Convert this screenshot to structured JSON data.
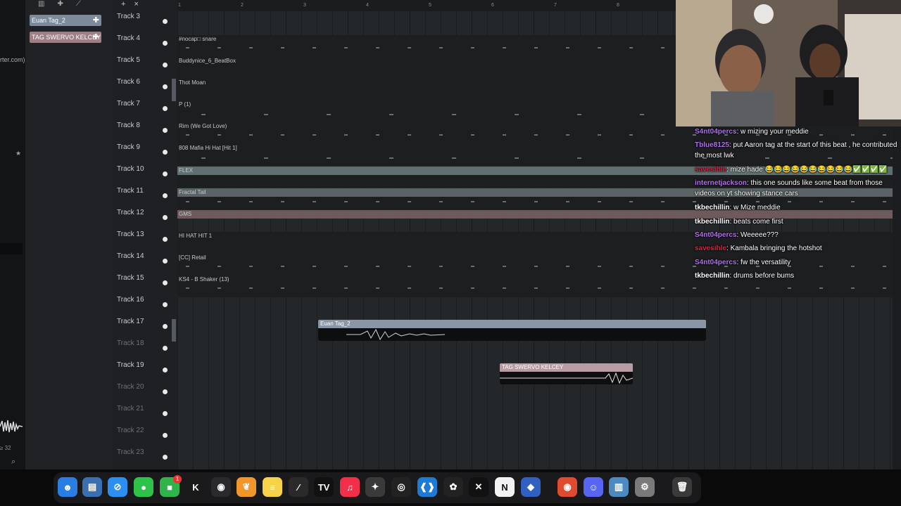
{
  "left_panel": {
    "url_fragment": "rter.com)",
    "star": "★",
    "zoom_label": "≥ 32"
  },
  "browser": {
    "patterns": [
      {
        "label": "Euan Tag_2"
      },
      {
        "label": "TAG SWERVO KELCEY"
      }
    ],
    "tool_icons": [
      "▥",
      "✚",
      "⟋"
    ]
  },
  "track_tools": {
    "add": "+",
    "close": "×"
  },
  "tracks": [
    {
      "label": "Track 3",
      "clip": ""
    },
    {
      "label": "Track 4",
      "clip": "#nocap□ snare"
    },
    {
      "label": "Track 5",
      "clip": "Buddynice_6_BeatBox"
    },
    {
      "label": "Track 6",
      "clip": "Thot Moan"
    },
    {
      "label": "Track 7",
      "clip": "P (1)"
    },
    {
      "label": "Track 8",
      "clip": "Rim (We Got Love)"
    },
    {
      "label": "Track 9",
      "clip": "808 Mafia Hi Hat [Hit 1]"
    },
    {
      "label": "Track 10",
      "clip": "FLEX"
    },
    {
      "label": "Track 11",
      "clip": "Fractal Tail"
    },
    {
      "label": "Track 12",
      "clip": "GMS"
    },
    {
      "label": "Track 13",
      "clip": "HI HAT HIT 1"
    },
    {
      "label": "Track 14",
      "clip": "[CC] Retail"
    },
    {
      "label": "Track 15",
      "clip": "KS4 - B Shaker (13)"
    },
    {
      "label": "Track 16",
      "clip": ""
    },
    {
      "label": "Track 17",
      "clip": "Euan Tag_2"
    },
    {
      "label": "Track 18",
      "clip": ""
    },
    {
      "label": "Track 19",
      "clip": "TAG SWERVO KELCEY"
    },
    {
      "label": "Track 20",
      "clip": ""
    },
    {
      "label": "Track 21",
      "clip": ""
    },
    {
      "label": "Track 22",
      "clip": ""
    },
    {
      "label": "Track 23",
      "clip": ""
    }
  ],
  "ruler": [
    "1",
    "2",
    "3",
    "4",
    "5",
    "6",
    "7",
    "8"
  ],
  "chat": [
    {
      "user": "S4nt04percs",
      "text": ": w mizing your meddie"
    },
    {
      "user": "Tblue8125",
      "text": ": put Aaron tag at the start of this beat , he contributed the most lwk"
    },
    {
      "user": "savesihle",
      "text": ": mize hade 😂😂😂😂😂😂😂😂😂😂✅✅✅✅"
    },
    {
      "user": "internetjackson",
      "text": ": this one sounds like some beat from those videos on yt showing stance cars"
    },
    {
      "user": "tkbechillin",
      "text": ": w Mize meddie"
    },
    {
      "user": "tkbechillin",
      "text": ": beats come first"
    },
    {
      "user": "S4nt04percs",
      "text": ": Weeeee???"
    },
    {
      "user": "savesihle",
      "text": ": Kambala bringing the hotshot"
    },
    {
      "user": "S4nt04percs",
      "text": ": fw the versatility"
    },
    {
      "user": "tkbechillin",
      "text": ": drums before bums"
    }
  ],
  "dock": [
    {
      "name": "finder",
      "glyph": "☻",
      "color": "#2a7de1"
    },
    {
      "name": "files",
      "glyph": "▤",
      "color": "#3a6fb0"
    },
    {
      "name": "safari",
      "glyph": "⊘",
      "color": "#2b8ef0"
    },
    {
      "name": "messages",
      "glyph": "●",
      "color": "#2fc24a"
    },
    {
      "name": "facetime",
      "glyph": "■",
      "color": "#2fb34a",
      "badge": "1"
    },
    {
      "name": "kick",
      "glyph": "K",
      "color": "#1a1a1a"
    },
    {
      "name": "obs",
      "glyph": "◉",
      "color": "#2a2a2e"
    },
    {
      "name": "fl-studio",
      "glyph": "❦",
      "color": "#f0962a"
    },
    {
      "name": "notes",
      "glyph": "≡",
      "color": "#f5d24a"
    },
    {
      "name": "pen-tool",
      "glyph": "∕",
      "color": "#2a2a2a"
    },
    {
      "name": "tradingview",
      "glyph": "TV",
      "color": "#111"
    },
    {
      "name": "music",
      "glyph": "♫",
      "color": "#f0304a"
    },
    {
      "name": "davinci-resolve",
      "glyph": "✦",
      "color": "#3a3a3a"
    },
    {
      "name": "github",
      "glyph": "◎",
      "color": "#222"
    },
    {
      "name": "vscode",
      "glyph": "❰❱",
      "color": "#1f7ad4"
    },
    {
      "name": "chatgpt",
      "glyph": "✿",
      "color": "#222"
    },
    {
      "name": "capcut",
      "glyph": "✕",
      "color": "#111"
    },
    {
      "name": "notion",
      "glyph": "N",
      "color": "#f2f2f2"
    },
    {
      "name": "roblox",
      "glyph": "◆",
      "color": "#3060c0"
    },
    {
      "name": "chrome",
      "glyph": "◉",
      "color": "#e04a30"
    },
    {
      "name": "discord",
      "glyph": "☺",
      "color": "#5865f2"
    },
    {
      "name": "soundboard",
      "glyph": "▥",
      "color": "#4a8ac0"
    },
    {
      "name": "system-settings",
      "glyph": "⚙",
      "color": "#7a7a7a"
    },
    {
      "name": "trash",
      "glyph": "🗑",
      "color": "#3a3a3a"
    }
  ]
}
